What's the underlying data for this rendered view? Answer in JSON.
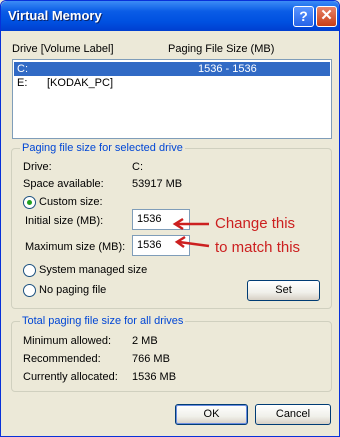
{
  "window": {
    "title": "Virtual Memory",
    "help_glyph": "?",
    "close_glyph": "✕"
  },
  "drives_header": {
    "drive": "Drive  [Volume Label]",
    "paging": "Paging File Size (MB)"
  },
  "drives": [
    {
      "drive": "C:",
      "label": "",
      "size": "1536 - 1536",
      "selected": true
    },
    {
      "drive": "E:",
      "label": "[KODAK_PC]",
      "size": "",
      "selected": false
    }
  ],
  "selected": {
    "title": "Paging file size for selected drive",
    "drive_label": "Drive:",
    "drive_value": "C:",
    "space_label": "Space available:",
    "space_value": "53917 MB",
    "custom_label": "Custom size:",
    "initial_label": "Initial size (MB):",
    "initial_value": "1536",
    "max_label": "Maximum size (MB):",
    "max_value": "1536",
    "system_label": "System managed size",
    "none_label": "No paging file",
    "set_label": "Set",
    "selected_option": "custom"
  },
  "annotation": {
    "line1": "Change this",
    "line2": "to match this",
    "color": "#cc2020"
  },
  "total": {
    "title": "Total paging file size for all drives",
    "min_label": "Minimum allowed:",
    "min_value": "2 MB",
    "rec_label": "Recommended:",
    "rec_value": "766 MB",
    "cur_label": "Currently allocated:",
    "cur_value": "1536 MB"
  },
  "buttons": {
    "ok": "OK",
    "cancel": "Cancel"
  }
}
